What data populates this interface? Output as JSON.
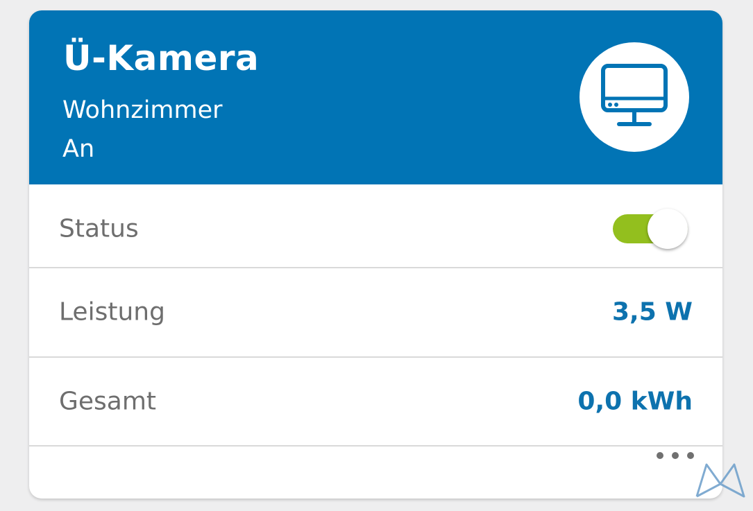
{
  "device": {
    "name": "Ü-Kamera",
    "room": "Wohnzimmer",
    "state": "An",
    "icon": "monitor-icon"
  },
  "rows": {
    "status": {
      "label": "Status",
      "toggle_on": true
    },
    "power": {
      "label": "Leistung",
      "value": "3,5 W"
    },
    "total": {
      "label": "Gesamt",
      "value": "0,0 kWh"
    }
  },
  "more_icon": "more-dots-icon",
  "colors": {
    "header": "#0174b5",
    "value_text": "#0d72ae",
    "toggle_on": "#93bf1e",
    "label_text": "#6e6e6e"
  }
}
